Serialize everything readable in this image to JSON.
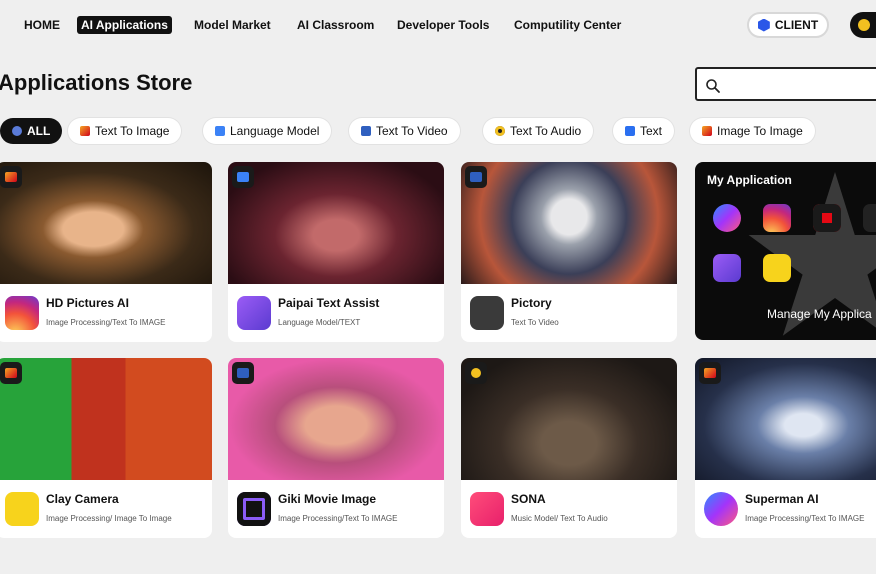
{
  "nav": {
    "items": [
      "HOME",
      "AI Applications",
      "Model Market",
      "AI Classroom",
      "Developer Tools",
      "Computility Center"
    ],
    "active": "AI Applications",
    "client_label": "CLIENT"
  },
  "page": {
    "title": "Applications Store",
    "search_placeholder": ""
  },
  "filters": [
    {
      "label": "ALL",
      "icon": "globe-icon",
      "active": true
    },
    {
      "label": "Text To Image",
      "icon": "image-icon"
    },
    {
      "label": "Language Model",
      "icon": "chat-icon"
    },
    {
      "label": "Text To Video",
      "icon": "video-icon"
    },
    {
      "label": "Text To Audio",
      "icon": "audio-icon"
    },
    {
      "label": "Text",
      "icon": "text-icon"
    },
    {
      "label": "Image To Image",
      "icon": "image-icon"
    }
  ],
  "cards": [
    {
      "name": "HD Pictures AI",
      "category": "Image Processing/Text To IMAGE",
      "badge": "image-icon",
      "app_icon": "instagram-icon"
    },
    {
      "name": "Paipai Text Assist",
      "category": "Language Model/TEXT",
      "badge": "chat-icon",
      "app_icon": "wave-hand-icon"
    },
    {
      "name": "Pictory",
      "category": "Text To Video",
      "badge": "video-icon",
      "app_icon": "sparkle-icon"
    },
    {
      "name": "Clay Camera",
      "category": "Image Processing/ Image To Image",
      "badge": "image-icon",
      "app_icon": "o-exclaim-icon"
    },
    {
      "name": "Giki Movie Image",
      "category": "Image Processing/Text To IMAGE",
      "badge": "video-icon",
      "app_icon": "moon-icon"
    },
    {
      "name": "SONA",
      "category": "Music Model/ Text To Audio",
      "badge": "audio-icon",
      "app_icon": "mixer-icon"
    },
    {
      "name": "Superman AI",
      "category": "Image Processing/Text To IMAGE",
      "badge": "image-icon",
      "app_icon": "messenger-icon"
    }
  ],
  "my_application": {
    "title": "My Application",
    "manage_label": "Manage My Applica",
    "icons": [
      "messenger-icon",
      "instagram-icon",
      "netflix-icon",
      "extra-icon",
      "wave-hand-icon",
      "o-exclaim-icon"
    ]
  },
  "colors": {
    "active_nav": "#111111",
    "client_hex": "#2a57e8",
    "coin": "#f2c020"
  }
}
